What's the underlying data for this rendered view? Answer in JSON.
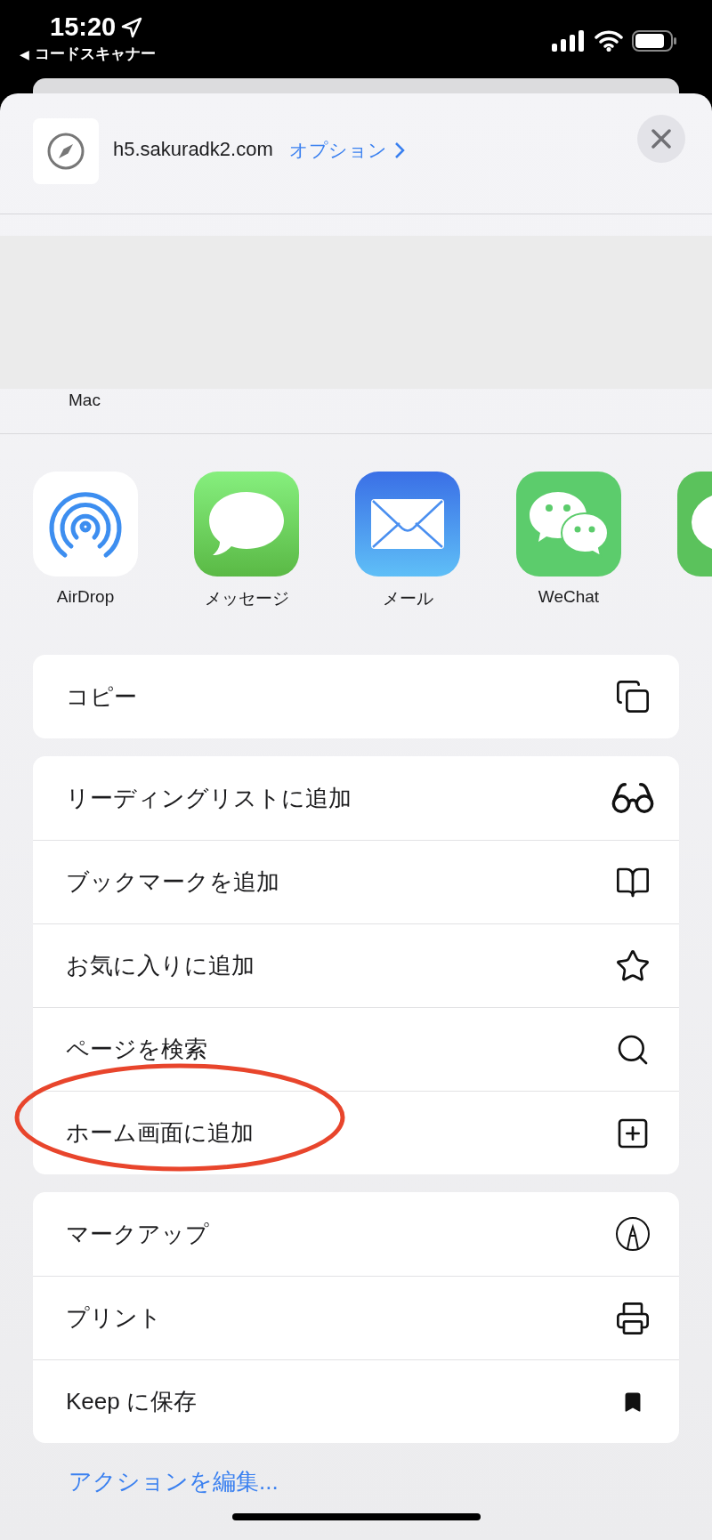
{
  "status_bar": {
    "time": "15:20",
    "back_arrow": "◀",
    "back_label": "コードスキャナー"
  },
  "share_header": {
    "site": "h5.sakuradk2.com",
    "options": "オプション"
  },
  "airdrop_people": {
    "device_label": "Mac"
  },
  "apps": [
    {
      "kind": "airdrop",
      "label": "AirDrop"
    },
    {
      "kind": "messages",
      "label": "メッセージ"
    },
    {
      "kind": "mail",
      "label": "メール"
    },
    {
      "kind": "wechat",
      "label": "WeChat"
    },
    {
      "kind": "line"
    }
  ],
  "action_groups": [
    [
      {
        "kind": "copy",
        "label": "コピー",
        "highlighted": false
      }
    ],
    [
      {
        "kind": "glasses",
        "label": "リーディングリストに追加",
        "highlighted": false
      },
      {
        "kind": "book",
        "label": "ブックマークを追加",
        "highlighted": false
      },
      {
        "kind": "star",
        "label": "お気に入りに追加",
        "highlighted": false
      },
      {
        "kind": "search",
        "label": "ページを検索",
        "highlighted": false
      },
      {
        "kind": "plus-square",
        "label": "ホーム画面に追加",
        "highlighted": true
      }
    ],
    [
      {
        "kind": "markup",
        "label": "マークアップ",
        "highlighted": false
      },
      {
        "kind": "printer",
        "label": "プリント",
        "highlighted": false
      },
      {
        "kind": "bookmark",
        "label": "Keep に保存",
        "highlighted": false
      }
    ]
  ],
  "edit_actions": "アクションを編集..."
}
